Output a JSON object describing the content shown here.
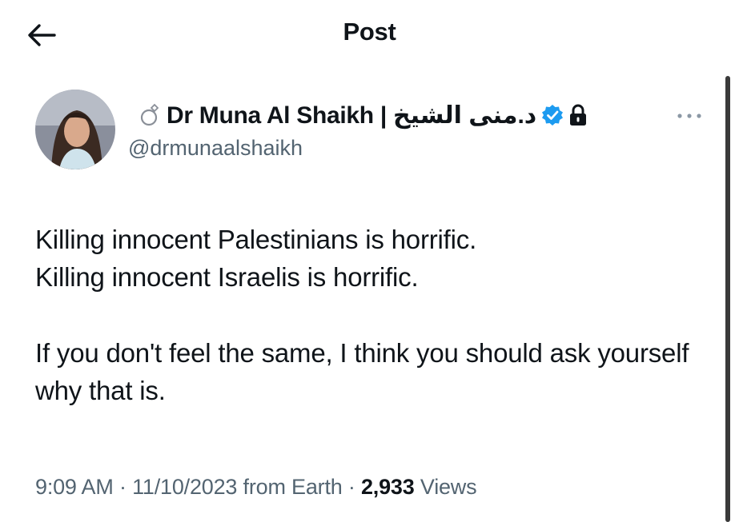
{
  "header": {
    "title": "Post",
    "back_icon": "arrow-left-icon"
  },
  "author": {
    "display_name": "Dr Muna Al Shaikh | د.منى الشيخ",
    "handle": "@drmunaalshaikh",
    "verified_color": "#1d9bf0",
    "icons": [
      "ring-icon",
      "verified-badge-icon",
      "lock-icon"
    ]
  },
  "more_icon": "more-horizontal-icon",
  "tweet": {
    "lines": [
      "Killing innocent Palestinians is horrific.",
      "Killing innocent Israelis is horrific.",
      "If you don't feel the same, I think you should ask yourself why that is."
    ]
  },
  "meta": {
    "time": "9:09 AM",
    "separator": " · ",
    "date": "11/10/2023",
    "source": "from Earth",
    "views_count": "2,933",
    "views_label": "Views"
  }
}
